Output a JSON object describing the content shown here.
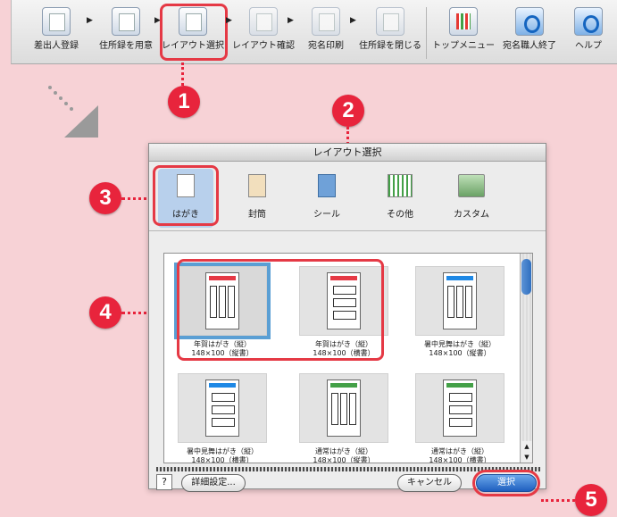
{
  "toolbar": {
    "items": [
      {
        "label": "差出人登録",
        "icon": "sender-register-icon"
      },
      {
        "label": "住所録を用意",
        "icon": "address-book-open-icon"
      },
      {
        "label": "レイアウト選択",
        "icon": "layout-select-icon"
      },
      {
        "label": "レイアウト確認",
        "icon": "layout-confirm-icon"
      },
      {
        "label": "宛名印刷",
        "icon": "printer-icon"
      },
      {
        "label": "住所録を閉じる",
        "icon": "address-book-close-icon"
      },
      {
        "label": "トップメニュー",
        "icon": "top-menu-icon"
      },
      {
        "label": "宛名職人終了",
        "icon": "power-icon"
      },
      {
        "label": "ヘルプ",
        "icon": "help-icon"
      }
    ]
  },
  "callouts": {
    "one": "1",
    "two": "2",
    "three": "3",
    "four": "4",
    "five": "5"
  },
  "dialog": {
    "title": "レイアウト選択",
    "tabs": [
      {
        "label": "はがき",
        "icon": "postcard-icon",
        "selected": true
      },
      {
        "label": "封筒",
        "icon": "envelope-icon"
      },
      {
        "label": "シール",
        "icon": "sticker-icon"
      },
      {
        "label": "その他",
        "icon": "other-icon"
      },
      {
        "label": "カスタム",
        "icon": "custom-icon"
      }
    ],
    "layouts": [
      {
        "name": "年賀はがき（縦）",
        "size": "148×100（縦書）",
        "selected": true
      },
      {
        "name": "年賀はがき（縦）",
        "size": "148×100（横書）"
      },
      {
        "name": "暑中見舞はがき（縦）",
        "size": "148×100（縦書）"
      },
      {
        "name": "暑中見舞はがき（縦）",
        "size": "148×100（横書）"
      },
      {
        "name": "通常はがき（縦）",
        "size": "148×100（縦書）"
      },
      {
        "name": "通常はがき（縦）",
        "size": "148×100（横書）"
      }
    ],
    "help_button": "?",
    "details_button": "詳細設定...",
    "cancel_button": "キャンセル",
    "ok_button": "選択"
  },
  "colors": {
    "accent": "#e8243c",
    "selection": "#5a9fd4",
    "background": "#f7d2d6"
  }
}
